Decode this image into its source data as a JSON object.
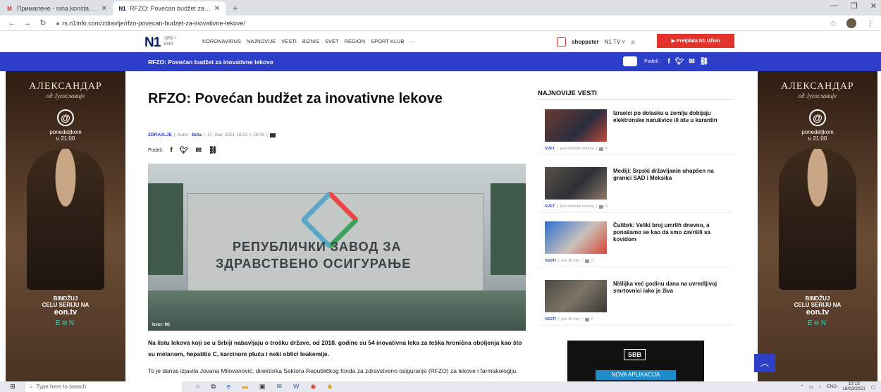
{
  "browser": {
    "tabs": [
      {
        "label": "Прималене - nina.konstantinido",
        "favicon": "M",
        "favicon_color": "#d93025",
        "active": false
      },
      {
        "label": "RFZO: Povećan budžet za inova",
        "favicon": "N1",
        "favicon_color": "#0a1a64",
        "active": true
      }
    ],
    "new_tab": "+",
    "url": "rs.n1info.com/zdravlje/rfzo-povecan-budzet-za-inovativne-lekove/"
  },
  "site": {
    "logo": "N1",
    "lang_primary": "SRB ˅",
    "lang_secondary": "ENG",
    "menu": [
      "KORONAVIRUS",
      "NAJNOVIJE",
      "VESTI",
      "BIZNIS",
      "SVET",
      "REGION",
      "SPORT KLUB",
      "···"
    ],
    "shoppster": "shoppster",
    "tv": "N1 TV ˅",
    "subscribe": "▶ Pretplata N1 Uživo",
    "accent": "#2d3ec8",
    "red": "#e4332c"
  },
  "band": {
    "title": "RFZO: Povećan budžet za inovativne lekove",
    "share_label": "Podeli :"
  },
  "article": {
    "headline": "RFZO: Povećan budžet za inovativne lekove",
    "category": "ZDRAVLJE",
    "author_label": "Autor:",
    "author": "Beta",
    "date": "17. mar. 2021 18:02 > 18:09",
    "share_label": "Podeli:",
    "photo_sign_line1": "РЕПУБЛИЧКИ ЗАВОД ЗА",
    "photo_sign_line2": "ЗДРАВСТВЕНО ОСИГУРАЊЕ",
    "photo_credit": "Izvor: N1",
    "lead": "Na listu lekova koji se u Srbiji nabavljaju o trošku države, od 2018. godine su 54 inovativna leka za teška hronična oboljenja kao što su melanom, hepatitis C, karcinom pluća i neki oblici leukemije.",
    "paragraph": "To je danas izjavila Jovana Milovanović, direktorka Sektora Republičkog fonda za zdravstveno osiguranje (RFZO) za lekove i farmakologiju."
  },
  "sidebar": {
    "title": "NAJNOVIJE VESTI",
    "items": [
      {
        "title": "Izraelci po dolasku u zemlju dobijaju elektronske narukvice ili idu u karantin",
        "category": "SVET",
        "time": "pre nekoliko minuta",
        "comments": "0"
      },
      {
        "title": "Mediji: Srpski državljanin uhapšen na granici SAD i Meksika",
        "category": "SVET",
        "time": "pre nekoliko minuta",
        "comments": "0"
      },
      {
        "title": "Čulibrk: Veliki broj umrlih dnevno, a ponašamo se kao da smo završili sa kovidom",
        "category": "VESTI",
        "time": "pre 28 min",
        "comments": "0"
      },
      {
        "title": "Nišlijka već godinu dana na uvredljivoj smrtovnici iako je živa",
        "category": "VESTI",
        "time": "pre 35 min",
        "comments": "0"
      }
    ]
  },
  "ads": {
    "brand": "АЛЕКСАНДАР",
    "brand_sub": "од Југославије",
    "logo": "@",
    "day": "ponedeljkom",
    "time": "u 21:00",
    "cta_line1": "BINDŽUJ",
    "cta_line2": "CELU SERIJU NA",
    "cta_site": "eon.tv",
    "eon": "E⊖N",
    "sbb": "SBB",
    "sbb_app": "NOVA APLIKACIJA"
  },
  "taskbar": {
    "search_placeholder": "Type here to search",
    "lang": "ENG",
    "time": "10:13",
    "date": "18/03/2021"
  }
}
